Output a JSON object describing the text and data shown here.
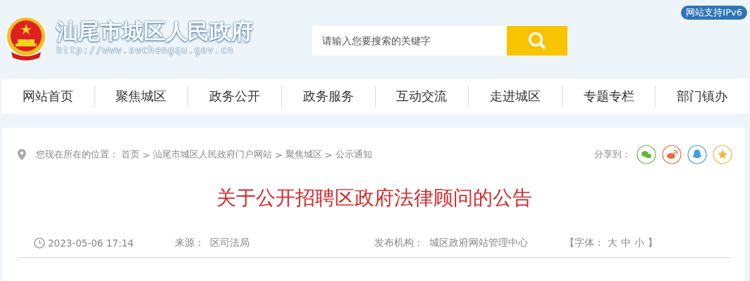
{
  "header": {
    "site_name": "汕尾市城区人民政府",
    "site_url": "http://www.swchengqu.gov.cn",
    "ipv6_badge": "网站支持IPv6",
    "search": {
      "placeholder": "请输入您要搜索的关键字"
    }
  },
  "nav": [
    {
      "label": "网站首页"
    },
    {
      "label": "聚焦城区"
    },
    {
      "label": "政务公开"
    },
    {
      "label": "政务服务"
    },
    {
      "label": "互动交流"
    },
    {
      "label": "走进城区"
    },
    {
      "label": "专题专栏"
    },
    {
      "label": "部门镇办"
    }
  ],
  "breadcrumb": {
    "prefix": "您现在所在的位置：",
    "items": [
      "首页",
      "汕尾市城区人民政府门户网站",
      "聚焦城区",
      "公示通知"
    ],
    "separator": ">"
  },
  "share": {
    "label": "分享到：",
    "targets": [
      {
        "kind": "wechat",
        "color": "#6ab43e"
      },
      {
        "kind": "weibo",
        "color": "#e8683a"
      },
      {
        "kind": "qq",
        "color": "#3d9ee3"
      },
      {
        "kind": "favorite",
        "color": "#f5b43a"
      }
    ]
  },
  "article": {
    "title": "关于公开招聘区政府法律顾问的公告",
    "date": "2023-05-06 17:14",
    "source_label": "来源：",
    "source": "区司法局",
    "publisher_label": "发布机构：",
    "publisher": "城区政府网站管理中心",
    "font_label": "【字体：",
    "font_sizes": [
      "大",
      "中",
      "小"
    ],
    "font_end": "】"
  }
}
